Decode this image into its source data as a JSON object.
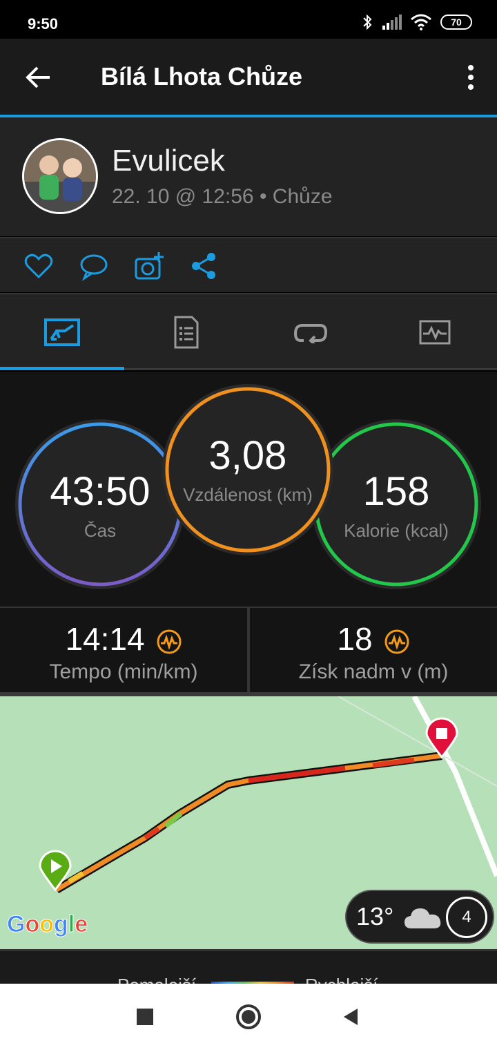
{
  "status": {
    "time": "9:50",
    "battery": "70"
  },
  "appbar": {
    "title": "Bílá Lhota Chůze"
  },
  "profile": {
    "name": "Evulicek",
    "meta": "22. 10 @ 12:56 • Chůze"
  },
  "social": {
    "icons": [
      "heart-icon",
      "comment-icon",
      "add-photo-icon",
      "share-icon"
    ]
  },
  "tabs": [
    "summary-tab",
    "details-tab",
    "laps-tab",
    "charts-tab"
  ],
  "stats": {
    "time": {
      "value": "43:50",
      "label": "Čas"
    },
    "distance": {
      "value": "3,08",
      "label": "Vzdálenost (km)"
    },
    "calories": {
      "value": "158",
      "label": "Kalorie (kcal)"
    }
  },
  "metrics": {
    "pace": {
      "value": "14:14",
      "label": "Tempo (min/km)"
    },
    "elevation": {
      "value": "18",
      "label": "Získ nadm v (m)"
    }
  },
  "map": {
    "weather_temp": "13°",
    "wind": "4",
    "brand": "Google"
  },
  "legend": {
    "slower": "Pomalejší",
    "faster": "Rychlejší"
  },
  "colors": {
    "accent": "#1b9be0",
    "time_ring": "#3f8fe0",
    "distance_ring": "#f0901e",
    "calories_ring": "#22c84a",
    "hr_icon": "#f39a1a"
  }
}
